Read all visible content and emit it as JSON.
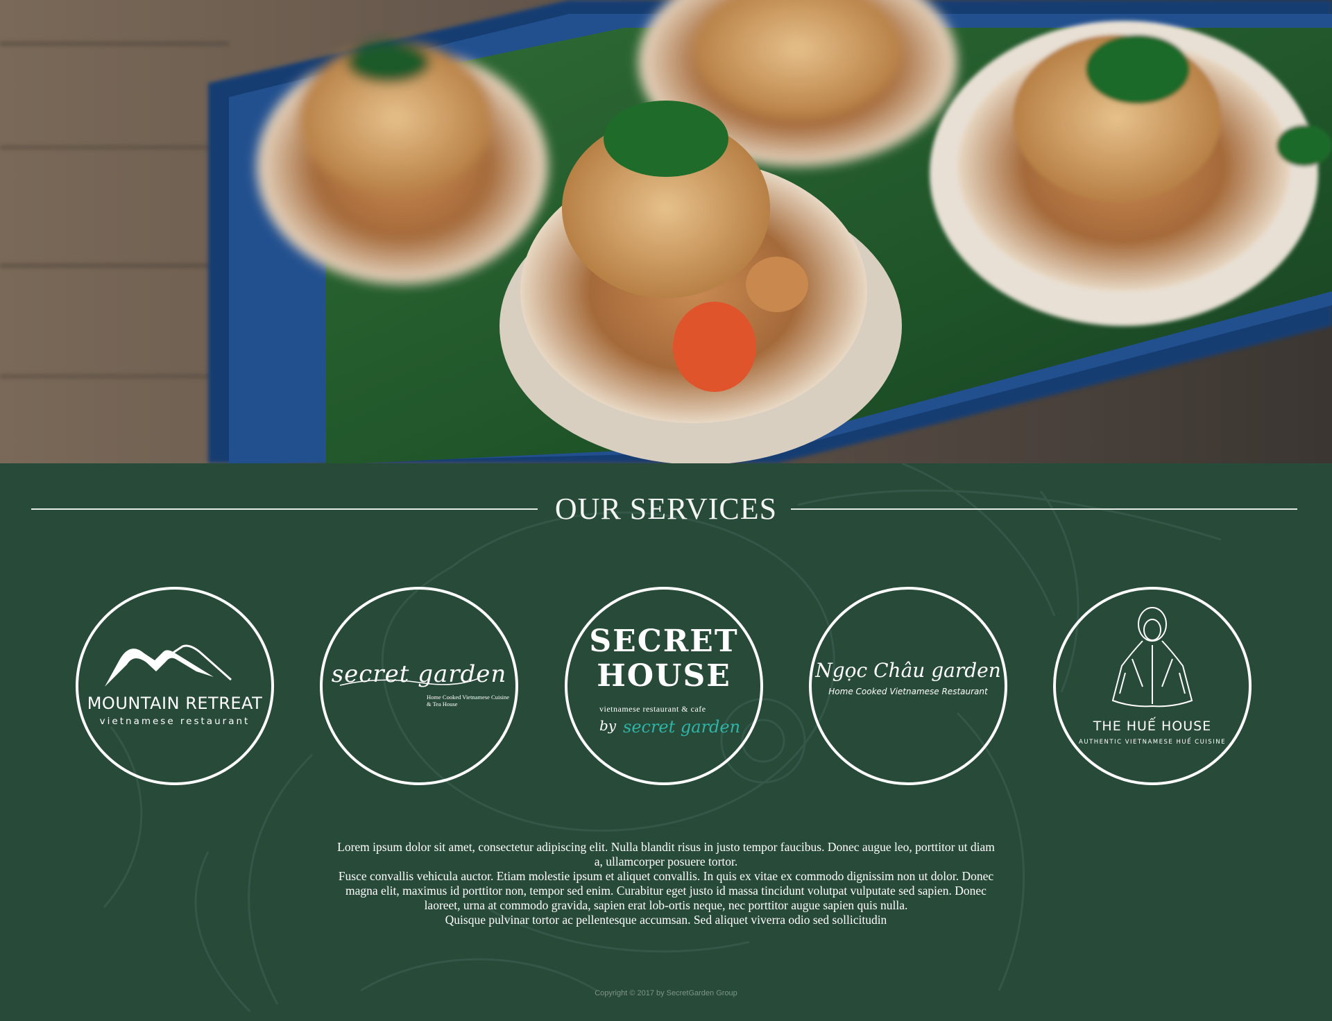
{
  "hero": {
    "image_alt": "food-photo"
  },
  "services": {
    "title": "OUR SERVICES",
    "brands": [
      {
        "name": "MOUNTAIN RETREAT",
        "tagline": "vietnamese restaurant"
      },
      {
        "name": "secret garden",
        "tagline_line1": "Home Cooked Vietnamese Cuisine",
        "tagline_line2": "& Tea House"
      },
      {
        "name_line1": "SECRET",
        "name_line2": "HOUSE",
        "tagline": "vietnamese restaurant & cafe",
        "by": "by",
        "by_brand": "secret garden"
      },
      {
        "name": "Ngọc Châu garden",
        "tagline": "Home Cooked Vietnamese Restaurant"
      },
      {
        "name": "THE HUẾ HOUSE",
        "tagline": "AUTHENTIC VIETNAMESE HUẾ CUISINE"
      }
    ],
    "paragraphs": [
      "Lorem ipsum dolor sit amet, consectetur adipiscing elit. Nulla blandit risus in justo tempor faucibus. Donec augue leo, porttitor ut diam a, ullamcorper posuere tortor.",
      "Fusce convallis vehicula auctor. Etiam molestie ipsum et aliquet convallis. In quis ex vitae ex commodo dignissim non ut dolor. Donec magna elit, maximus id porttitor non, tempor sed enim. Curabitur eget justo id massa tincidunt volutpat vulputate sed sapien. Donec laoreet, urna at commodo gravida, sapien erat lob-ortis neque, nec porttitor augue sapien quis nulla.",
      "Quisque pulvinar tortor ac pellentesque accumsan. Sed aliquet viverra odio sed sollicitudin"
    ],
    "copyright": "Copyright © 2017 by SecretGarden Group"
  },
  "colors": {
    "background": "#284a39",
    "text": "#ffffff",
    "accent_teal": "#2fb5a8"
  }
}
